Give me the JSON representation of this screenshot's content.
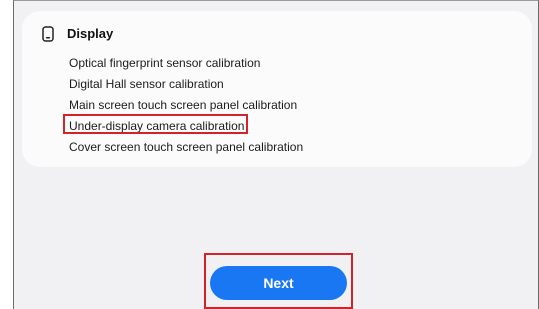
{
  "section": {
    "title": "Display",
    "icon": "phone-icon"
  },
  "items": [
    {
      "label": "Optical fingerprint sensor calibration"
    },
    {
      "label": "Digital Hall sensor calibration"
    },
    {
      "label": "Main screen touch screen panel calibration"
    },
    {
      "label": "Under-display camera calibration",
      "highlighted": true
    },
    {
      "label": "Cover screen touch screen panel calibration"
    }
  ],
  "next_button": {
    "label": "Next",
    "highlighted": true
  },
  "colors": {
    "accent": "#1977f3",
    "highlight": "#d2232a"
  }
}
